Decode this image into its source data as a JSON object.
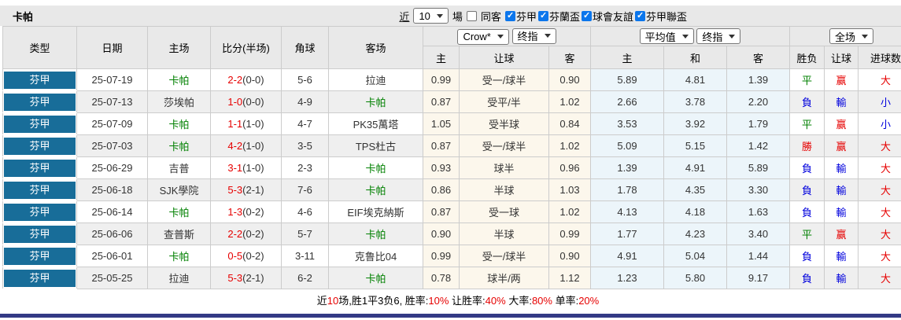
{
  "title_bar": {
    "title": "卡帕",
    "near_label": "近",
    "matches_count": "10",
    "matches_label": "場",
    "same_away_label": "同客",
    "competitions": [
      {
        "label": "芬甲",
        "checked": true
      },
      {
        "label": "芬蘭盃",
        "checked": true
      },
      {
        "label": "球會友誼",
        "checked": true
      },
      {
        "label": "芬甲聯盃",
        "checked": true
      }
    ]
  },
  "table": {
    "left_headers": [
      "类型",
      "日期",
      "主场",
      "比分(半场)",
      "角球",
      "客场"
    ],
    "odds_group": {
      "selects": [
        "Crow*",
        "终指"
      ],
      "sub": [
        "主",
        "让球",
        "客"
      ]
    },
    "avg_group": {
      "selects": [
        "平均值",
        "终指"
      ],
      "sub": [
        "主",
        "和",
        "客"
      ]
    },
    "result_group": {
      "selects": [
        "全场"
      ],
      "sub": [
        "胜负",
        "让球",
        "进球数"
      ]
    },
    "rows": [
      {
        "league": "芬甲",
        "date": "25-07-19",
        "home": "卡帕",
        "home_self": true,
        "score": "2-2",
        "half": "(0-0)",
        "corner": "5-6",
        "away": "拉迪",
        "away_self": false,
        "odds_home": "0.99",
        "handicap": "受一/球半",
        "odds_away": "0.90",
        "avg_home": "5.89",
        "avg_draw": "4.81",
        "avg_away": "1.39",
        "result": "平",
        "result_color": "green",
        "handicap_result": "赢",
        "handicap_color": "red",
        "goals": "大",
        "goals_color": "red"
      },
      {
        "league": "芬甲",
        "date": "25-07-13",
        "home": "莎埃帕",
        "home_self": false,
        "score": "1-0",
        "half": "(0-0)",
        "corner": "4-9",
        "away": "卡帕",
        "away_self": true,
        "odds_home": "0.87",
        "handicap": "受平/半",
        "odds_away": "1.02",
        "avg_home": "2.66",
        "avg_draw": "3.78",
        "avg_away": "2.20",
        "result": "負",
        "result_color": "blue",
        "handicap_result": "輸",
        "handicap_color": "blue",
        "goals": "小",
        "goals_color": "blue"
      },
      {
        "league": "芬甲",
        "date": "25-07-09",
        "home": "卡帕",
        "home_self": true,
        "score": "1-1",
        "half": "(1-0)",
        "corner": "4-7",
        "away": "PK35萬塔",
        "away_self": false,
        "odds_home": "1.05",
        "handicap": "受半球",
        "odds_away": "0.84",
        "avg_home": "3.53",
        "avg_draw": "3.92",
        "avg_away": "1.79",
        "result": "平",
        "result_color": "green",
        "handicap_result": "赢",
        "handicap_color": "red",
        "goals": "小",
        "goals_color": "blue"
      },
      {
        "league": "芬甲",
        "date": "25-07-03",
        "home": "卡帕",
        "home_self": true,
        "score": "4-2",
        "half": "(1-0)",
        "corner": "3-5",
        "away": "TPS杜古",
        "away_self": false,
        "odds_home": "0.87",
        "handicap": "受一/球半",
        "odds_away": "1.02",
        "avg_home": "5.09",
        "avg_draw": "5.15",
        "avg_away": "1.42",
        "result": "勝",
        "result_color": "red",
        "handicap_result": "赢",
        "handicap_color": "red",
        "goals": "大",
        "goals_color": "red"
      },
      {
        "league": "芬甲",
        "date": "25-06-29",
        "home": "吉普",
        "home_self": false,
        "score": "3-1",
        "half": "(1-0)",
        "corner": "2-3",
        "away": "卡帕",
        "away_self": true,
        "odds_home": "0.93",
        "handicap": "球半",
        "odds_away": "0.96",
        "avg_home": "1.39",
        "avg_draw": "4.91",
        "avg_away": "5.89",
        "result": "負",
        "result_color": "blue",
        "handicap_result": "輸",
        "handicap_color": "blue",
        "goals": "大",
        "goals_color": "red"
      },
      {
        "league": "芬甲",
        "date": "25-06-18",
        "home": "SJK學院",
        "home_self": false,
        "score": "5-3",
        "half": "(2-1)",
        "corner": "7-6",
        "away": "卡帕",
        "away_self": true,
        "odds_home": "0.86",
        "handicap": "半球",
        "odds_away": "1.03",
        "avg_home": "1.78",
        "avg_draw": "4.35",
        "avg_away": "3.30",
        "result": "負",
        "result_color": "blue",
        "handicap_result": "輸",
        "handicap_color": "blue",
        "goals": "大",
        "goals_color": "red"
      },
      {
        "league": "芬甲",
        "date": "25-06-14",
        "home": "卡帕",
        "home_self": true,
        "score": "1-3",
        "half": "(0-2)",
        "corner": "4-6",
        "away": "EIF埃克納斯",
        "away_self": false,
        "odds_home": "0.87",
        "handicap": "受一球",
        "odds_away": "1.02",
        "avg_home": "4.13",
        "avg_draw": "4.18",
        "avg_away": "1.63",
        "result": "負",
        "result_color": "blue",
        "handicap_result": "輸",
        "handicap_color": "blue",
        "goals": "大",
        "goals_color": "red"
      },
      {
        "league": "芬甲",
        "date": "25-06-06",
        "home": "查普斯",
        "home_self": false,
        "score": "2-2",
        "half": "(0-2)",
        "corner": "5-7",
        "away": "卡帕",
        "away_self": true,
        "odds_home": "0.90",
        "handicap": "半球",
        "odds_away": "0.99",
        "avg_home": "1.77",
        "avg_draw": "4.23",
        "avg_away": "3.40",
        "result": "平",
        "result_color": "green",
        "handicap_result": "赢",
        "handicap_color": "red",
        "goals": "大",
        "goals_color": "red"
      },
      {
        "league": "芬甲",
        "date": "25-06-01",
        "home": "卡帕",
        "home_self": true,
        "score": "0-5",
        "half": "(0-2)",
        "corner": "3-11",
        "away": "克鲁比04",
        "away_self": false,
        "odds_home": "0.99",
        "handicap": "受一/球半",
        "odds_away": "0.90",
        "avg_home": "4.91",
        "avg_draw": "5.04",
        "avg_away": "1.44",
        "result": "負",
        "result_color": "blue",
        "handicap_result": "輸",
        "handicap_color": "blue",
        "goals": "大",
        "goals_color": "red"
      },
      {
        "league": "芬甲",
        "date": "25-05-25",
        "home": "拉迪",
        "home_self": false,
        "score": "5-3",
        "half": "(2-1)",
        "corner": "6-2",
        "away": "卡帕",
        "away_self": true,
        "odds_home": "0.78",
        "handicap": "球半/两",
        "odds_away": "1.12",
        "avg_home": "1.23",
        "avg_draw": "5.80",
        "avg_away": "9.17",
        "result": "負",
        "result_color": "blue",
        "handicap_result": "輸",
        "handicap_color": "blue",
        "goals": "大",
        "goals_color": "red"
      }
    ]
  },
  "footer": {
    "segments": [
      {
        "text": "近",
        "red": false
      },
      {
        "text": "10",
        "red": true
      },
      {
        "text": "场,胜1平3负6, 胜率:",
        "red": false
      },
      {
        "text": "10%",
        "red": true
      },
      {
        "text": " 让胜率:",
        "red": false
      },
      {
        "text": "40%",
        "red": true
      },
      {
        "text": " 大率:",
        "red": false
      },
      {
        "text": "80%",
        "red": true
      },
      {
        "text": " 单率:",
        "red": false
      },
      {
        "text": "20%",
        "red": true
      }
    ]
  },
  "colors": {
    "league_pill": "#186d99",
    "win_red": "#e60000",
    "lose_blue": "#0000dd",
    "draw_green": "#008000",
    "team_green": "#008000",
    "odds_cream_bg": "#fcf7ec",
    "avg_azure_bg": "#ecf5fa",
    "header_gray_bg": "#e9e9e9",
    "alt_row_bg": "#efefef",
    "checkbox_blue": "#0b76ec",
    "bottom_bar_blue": "#333a85"
  }
}
